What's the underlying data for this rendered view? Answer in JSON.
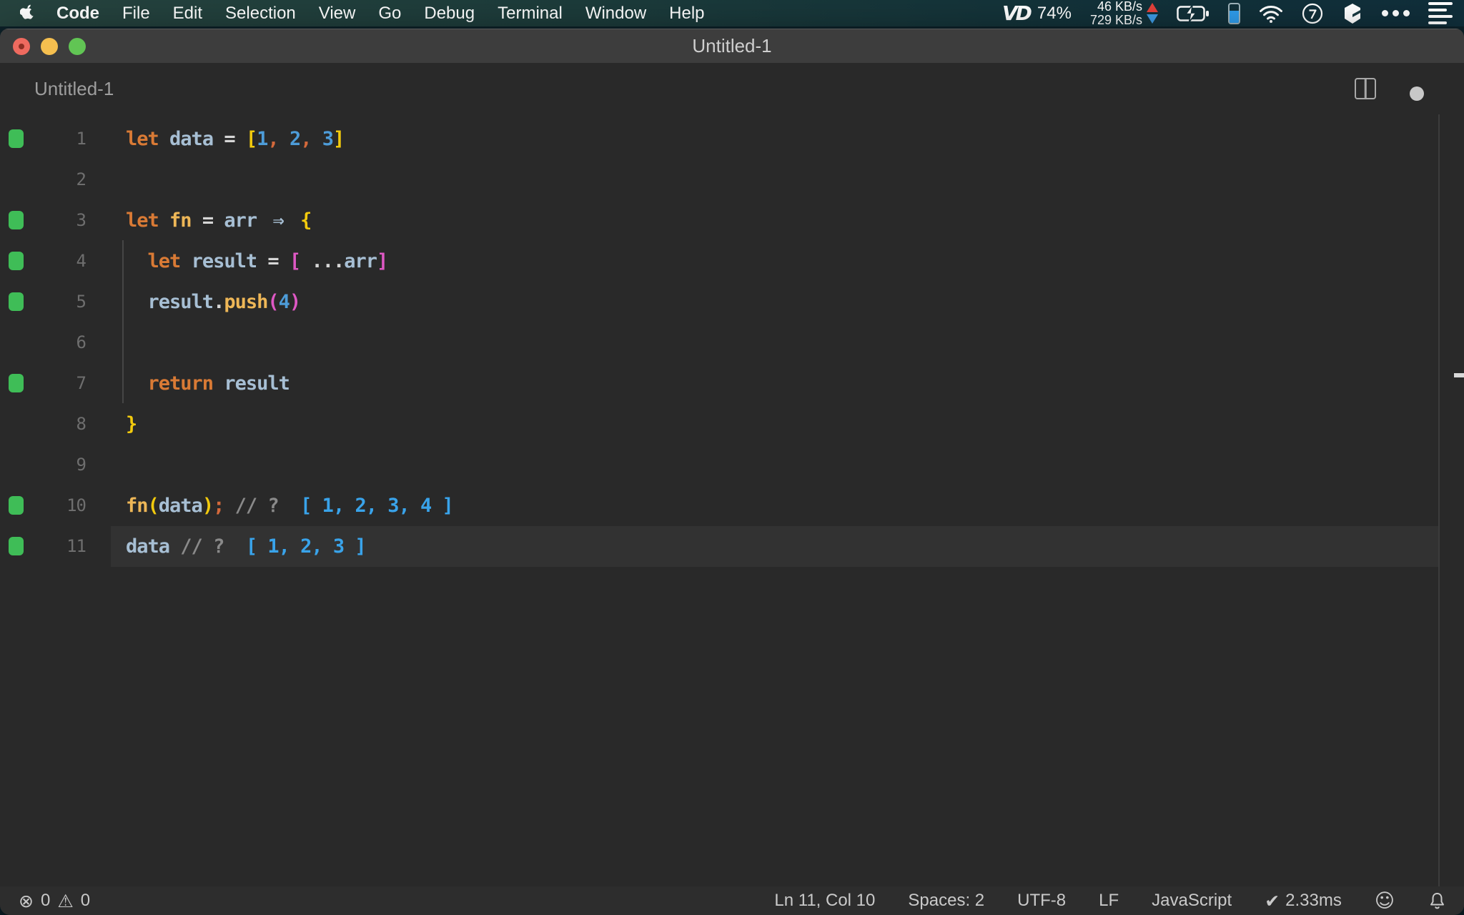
{
  "menubar": {
    "items": [
      "Code",
      "File",
      "Edit",
      "Selection",
      "View",
      "Go",
      "Debug",
      "Terminal",
      "Window",
      "Help"
    ],
    "bold_item": "Code",
    "vd_logo": "VD",
    "battery_percent": "74%",
    "net_up": "46 KB/s",
    "net_down": "729 KB/s"
  },
  "window": {
    "title": "Untitled-1",
    "tab_label": "Untitled-1"
  },
  "editor": {
    "language_note": "JavaScript",
    "lines": [
      {
        "num": "1",
        "marker": true,
        "current": false,
        "tokens": [
          [
            "kw",
            "let"
          ],
          [
            "op",
            " "
          ],
          [
            "vr",
            "data"
          ],
          [
            "op",
            " "
          ],
          [
            "op",
            "="
          ],
          [
            "op",
            " "
          ],
          [
            "b1",
            "["
          ],
          [
            "nu",
            "1"
          ],
          [
            "pu",
            ","
          ],
          [
            "op",
            " "
          ],
          [
            "nu",
            "2"
          ],
          [
            "pu",
            ","
          ],
          [
            "op",
            " "
          ],
          [
            "nu",
            "3"
          ],
          [
            "b1",
            "]"
          ]
        ]
      },
      {
        "num": "2",
        "marker": false,
        "current": false,
        "tokens": []
      },
      {
        "num": "3",
        "marker": true,
        "current": false,
        "tokens": [
          [
            "kw",
            "let"
          ],
          [
            "op",
            " "
          ],
          [
            "fn",
            "fn"
          ],
          [
            "op",
            " "
          ],
          [
            "op",
            "="
          ],
          [
            "op",
            " "
          ],
          [
            "vr",
            "arr"
          ],
          [
            "op",
            " "
          ],
          [
            "ar",
            "⇒"
          ],
          [
            "op",
            " "
          ],
          [
            "b1",
            "{"
          ]
        ]
      },
      {
        "num": "4",
        "marker": true,
        "current": false,
        "tokens": [
          [
            "op",
            "  "
          ],
          [
            "kw",
            "let"
          ],
          [
            "op",
            " "
          ],
          [
            "vr",
            "result"
          ],
          [
            "op",
            " "
          ],
          [
            "op",
            "="
          ],
          [
            "op",
            " "
          ],
          [
            "b2",
            "["
          ],
          [
            "op",
            " "
          ],
          [
            "sp3",
            "..."
          ],
          [
            "vr",
            "arr"
          ],
          [
            "b2",
            "]"
          ]
        ]
      },
      {
        "num": "5",
        "marker": true,
        "current": false,
        "tokens": [
          [
            "op",
            "  "
          ],
          [
            "vr",
            "result"
          ],
          [
            "op",
            "."
          ],
          [
            "fn",
            "push"
          ],
          [
            "b2",
            "("
          ],
          [
            "nu",
            "4"
          ],
          [
            "b2",
            ")"
          ]
        ]
      },
      {
        "num": "6",
        "marker": false,
        "current": false,
        "tokens": []
      },
      {
        "num": "7",
        "marker": true,
        "current": false,
        "tokens": [
          [
            "op",
            "  "
          ],
          [
            "kw",
            "return"
          ],
          [
            "op",
            " "
          ],
          [
            "vr",
            "result"
          ]
        ]
      },
      {
        "num": "8",
        "marker": false,
        "current": false,
        "tokens": [
          [
            "b1",
            "}"
          ]
        ]
      },
      {
        "num": "9",
        "marker": false,
        "current": false,
        "tokens": []
      },
      {
        "num": "10",
        "marker": true,
        "current": false,
        "tokens": [
          [
            "fn",
            "fn"
          ],
          [
            "b1",
            "("
          ],
          [
            "vr",
            "data"
          ],
          [
            "b1",
            ")"
          ],
          [
            "pu",
            ";"
          ],
          [
            "op",
            " "
          ],
          [
            "cm",
            "//"
          ],
          [
            "op",
            " "
          ],
          [
            "cm",
            "?"
          ],
          [
            "op",
            "  "
          ],
          [
            "out",
            "[ 1, 2, 3, 4 ]"
          ]
        ]
      },
      {
        "num": "11",
        "marker": true,
        "current": true,
        "tokens": [
          [
            "vr",
            "data"
          ],
          [
            "op",
            " "
          ],
          [
            "cm",
            "//"
          ],
          [
            "op",
            " "
          ],
          [
            "cm",
            "?"
          ],
          [
            "op",
            "  "
          ],
          [
            "out",
            "[ 1, 2, 3 ]"
          ]
        ]
      }
    ]
  },
  "statusbar": {
    "errors": "0",
    "warnings": "0",
    "error_symbol": "⊗",
    "warning_symbol": "⚠",
    "items": [
      "Ln 11, Col 10",
      "Spaces: 2",
      "UTF-8",
      "LF",
      "JavaScript"
    ],
    "perf_check": "✔",
    "perf_time": "2.33ms",
    "smiley_symbol": "☺"
  },
  "icons": {
    "menubar_right": [
      "vd-battery-app",
      "network-speed",
      "battery-charging",
      "device-battery",
      "wifi",
      "clock-7",
      "app-cube",
      "ellipsis",
      "list"
    ]
  }
}
